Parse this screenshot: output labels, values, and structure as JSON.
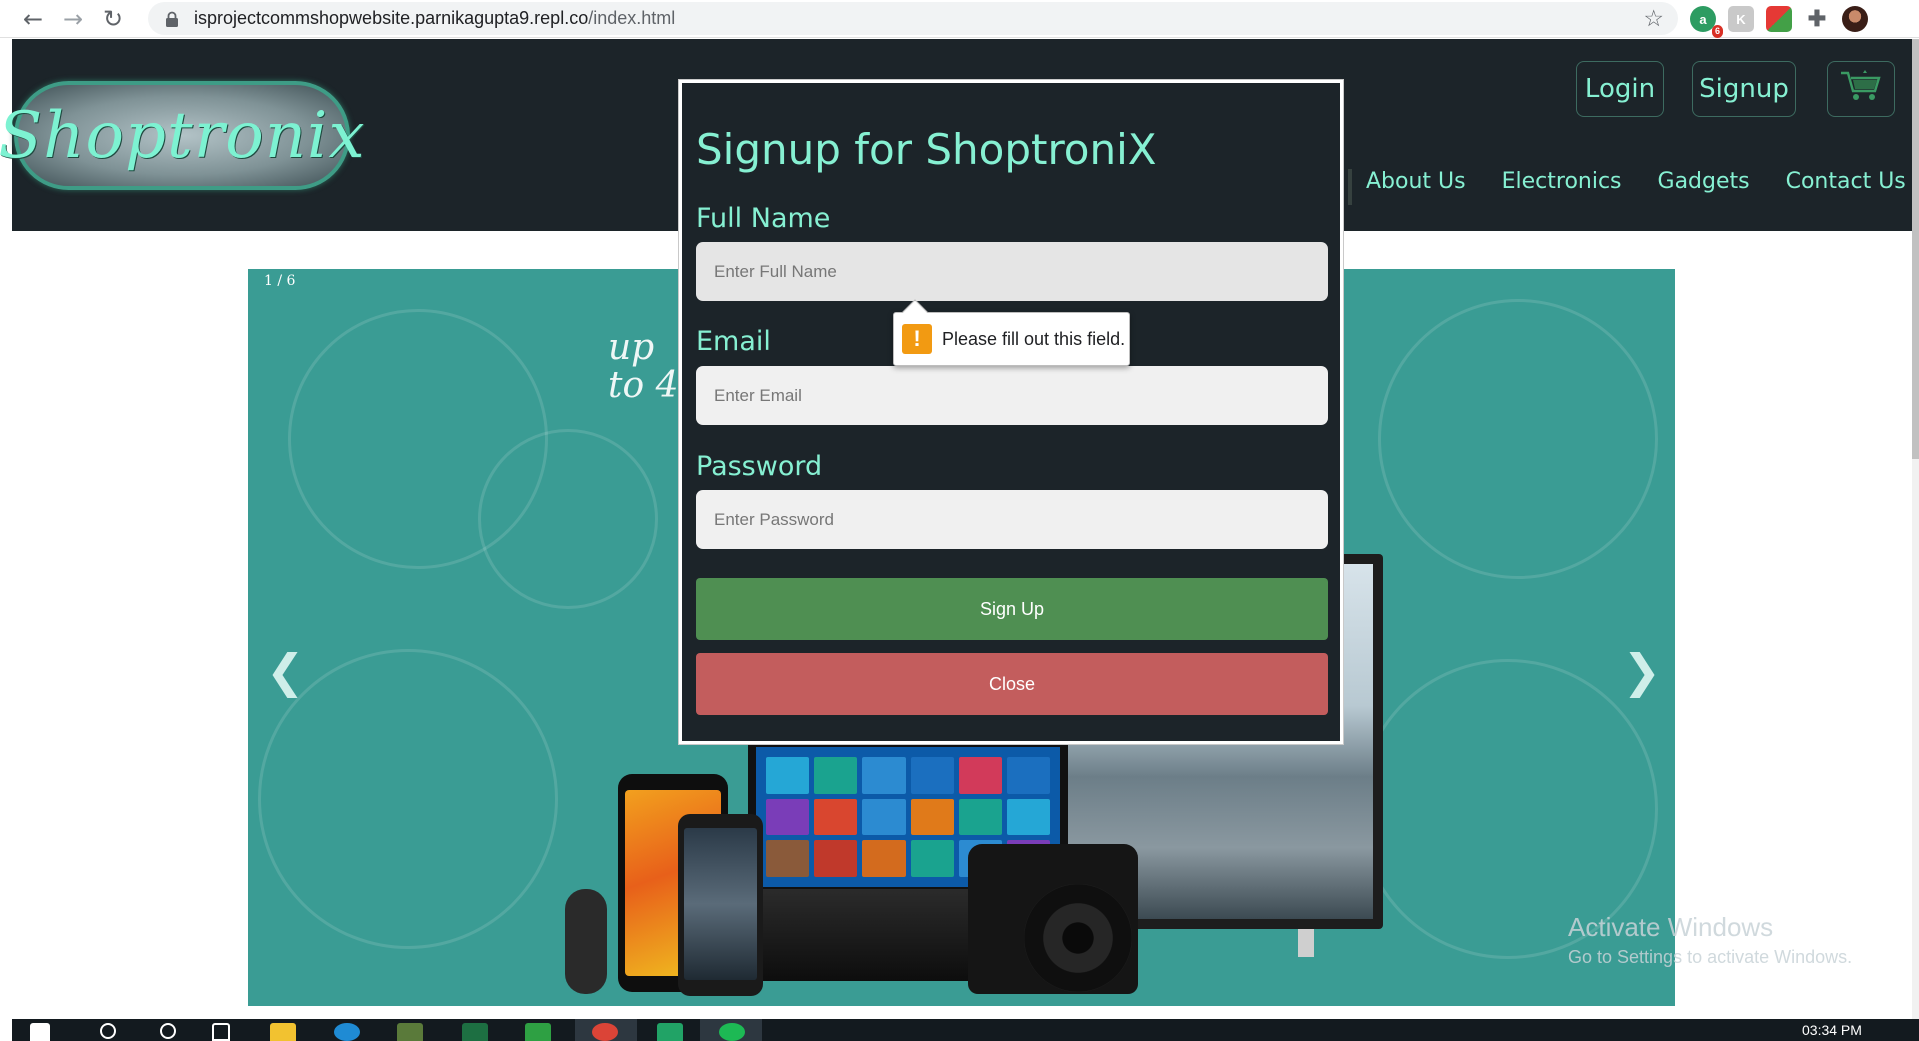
{
  "browser": {
    "url_host": "isprojectcommshopwebsite.parnikagupta9.repl.co",
    "url_path": "/index.html",
    "extension_badge": "6"
  },
  "header": {
    "logo_text": "Shoptronix",
    "login_label": "Login",
    "signup_label": "Signup",
    "nav": [
      "About Us",
      "Electronics",
      "Gadgets",
      "Contact Us"
    ]
  },
  "carousel": {
    "counter": "1 / 6",
    "promo_line1": "up",
    "promo_line2": "to 4",
    "prev_label": "❮",
    "next_label": "❯"
  },
  "modal": {
    "title": "Signup for ShoptroniX",
    "full_name_label": "Full Name",
    "full_name_placeholder": "Enter Full Name",
    "email_label": "Email",
    "email_placeholder": "Enter Email",
    "password_label": "Password",
    "password_placeholder": "Enter Password",
    "submit_label": "Sign Up",
    "close_label": "Close"
  },
  "tooltip": {
    "icon": "!",
    "message": "Please fill out this field."
  },
  "watermark": {
    "title": "Activate Windows",
    "subtitle": "Go to Settings to activate Windows."
  },
  "taskbar": {
    "clock": "03:34 PM"
  },
  "colors": {
    "header_bg": "#1c2429",
    "accent": "#86f0d2",
    "signup_green": "#4f8f52",
    "close_red": "#c35d5d",
    "carousel_teal": "#3a9c94",
    "warning_orange": "#f29a12"
  },
  "icons": {
    "back": "arrow-left-icon",
    "forward": "arrow-right-icon",
    "reload": "reload-icon",
    "lock": "lock-icon",
    "star": "star-icon",
    "extensions": "puzzle-icon",
    "cart": "shopping-cart-icon",
    "warning": "warning-icon"
  }
}
